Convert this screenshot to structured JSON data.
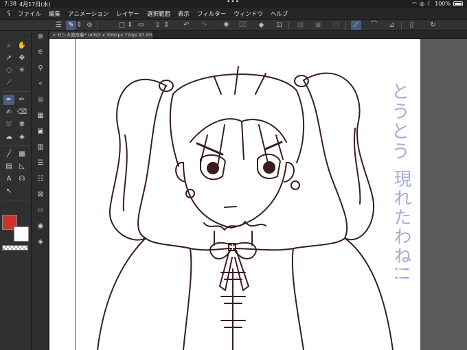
{
  "status": {
    "time": "7:38",
    "date": "4月17日(水)",
    "dots": "•••",
    "battery": "100%"
  },
  "menu": {
    "logo_icon": "clip-studio-logo",
    "items": [
      "ファイル",
      "編集",
      "アニメーション",
      "レイヤー",
      "選択範囲",
      "表示",
      "フィルター",
      "ウィンドウ",
      "ヘルプ"
    ]
  },
  "document": {
    "tab_title": "ゼシカ普段着* (4093 x 3092px 72dpi 97.9%)"
  },
  "canvas": {
    "vertical_text_right": "とうとう",
    "vertical_text_left": "現れたわね!!"
  },
  "colors": {
    "main": "#c8342c",
    "sub": "#ffffff",
    "line_art": "#3a1d1d",
    "ruler": "#9aa6d2",
    "handwriting": "#a5add8"
  }
}
